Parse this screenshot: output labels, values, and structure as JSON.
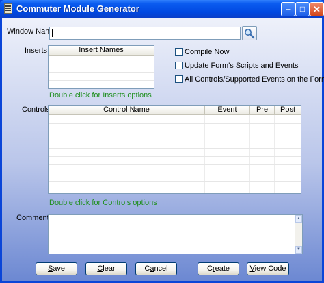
{
  "window": {
    "title": "Commuter Module Generator",
    "controls": {
      "minimize": "–",
      "maximize": "□",
      "close": "✕"
    }
  },
  "form": {
    "window_name_label": "Window Name",
    "window_name_value": "",
    "inserts_label": "Inserts",
    "inserts_header": "Insert Names",
    "inserts_hint": "Double click for Inserts options",
    "options": [
      {
        "label": "Compile Now",
        "checked": false
      },
      {
        "label": "Update Form's Scripts and Events",
        "checked": false
      },
      {
        "label": "All Controls/Supported Events on the Form",
        "checked": false
      }
    ],
    "controls_label": "Controls",
    "controls_headers": [
      "Control Name",
      "Event",
      "Pre",
      "Post"
    ],
    "controls_hint": "Double click for Controls options",
    "comments_label": "Comments",
    "comments_value": ""
  },
  "buttons": [
    {
      "pre": "",
      "acc": "S",
      "post": "ave"
    },
    {
      "pre": "",
      "acc": "C",
      "post": "lear"
    },
    {
      "pre": "C",
      "acc": "a",
      "post": "ncel"
    },
    {
      "pre": "C",
      "acc": "r",
      "post": "eate"
    },
    {
      "pre": "",
      "acc": "V",
      "post": "iew Code"
    }
  ],
  "icons": {
    "app": "form-app-icon",
    "search": "magnifier-icon"
  },
  "colors": {
    "hint": "#1f8f1f",
    "title_bar": "#0048e0",
    "close_button": "#d2461c"
  }
}
